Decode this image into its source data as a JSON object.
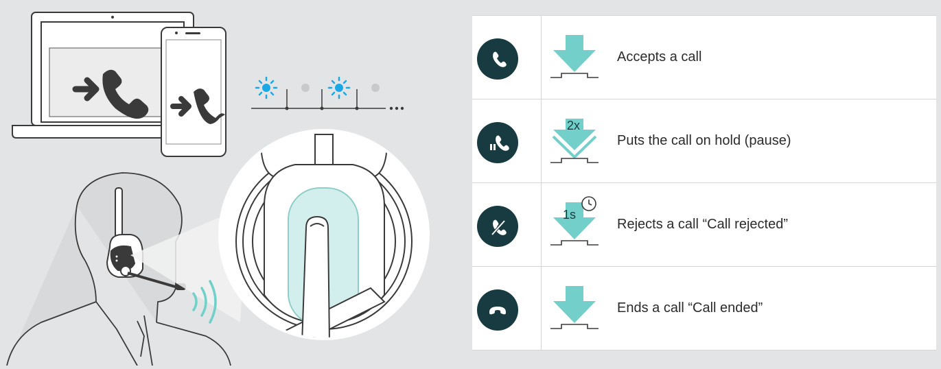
{
  "colors": {
    "background": "#e3e4e6",
    "icon_circle": "#173b40",
    "press_arrow": "#72cfc9",
    "led_blue": "#1aa9e6",
    "led_off": "#c8c9cb",
    "illustration_stroke": "#3a3a3a"
  },
  "illustration": {
    "laptop_icon": "incoming-call-icon",
    "phone_icon": "incoming-call-icon",
    "led_pattern": [
      "blue-flash",
      "off",
      "blue-flash",
      "off"
    ]
  },
  "actions": [
    {
      "icon": "phone-accept-icon",
      "press": "single-press",
      "badge": "",
      "label": "Accepts a call"
    },
    {
      "icon": "phone-hold-icon",
      "press": "double-press",
      "badge": "2x",
      "label": "Puts the call on hold (pause)"
    },
    {
      "icon": "phone-reject-icon",
      "press": "long-press",
      "badge": "1s",
      "label": "Rejects a call “Call rejected”"
    },
    {
      "icon": "phone-end-icon",
      "press": "single-press",
      "badge": "",
      "label": "Ends a call “Call ended”"
    }
  ]
}
